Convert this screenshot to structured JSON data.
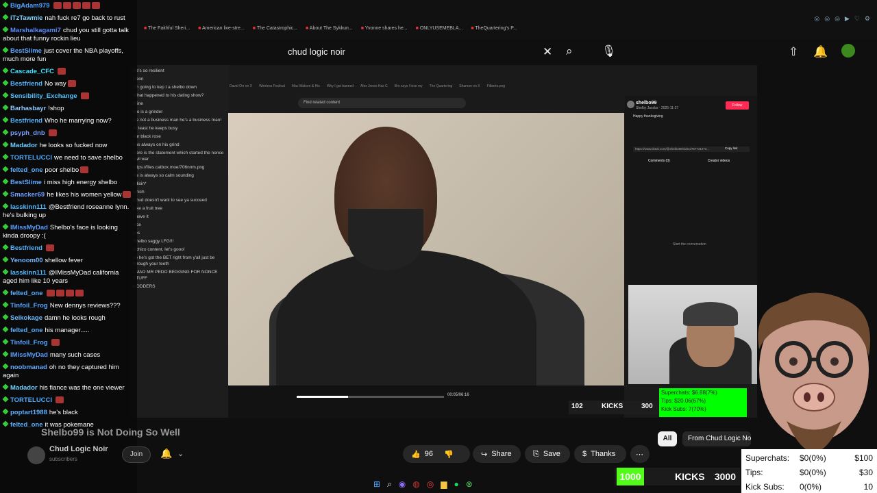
{
  "search": {
    "query": "chud logic noir"
  },
  "bookmarks": [
    "The Faithful Sheri...",
    "American live-stre...",
    "The Catastrophic...",
    "About The Sykkun...",
    "Yvonne shares he...",
    "ONLYUSEMEBLA...",
    "TheQuartering's P..."
  ],
  "chat": [
    {
      "user": "BigAdam979",
      "color": "#4ea1ff",
      "msg": "",
      "emotes": 5
    },
    {
      "user": "iTzTawmie",
      "color": "#7fd3ff",
      "msg": "nah fuck re7 go back to rust",
      "emotes": 0
    },
    {
      "user": "Marshalkagami7",
      "color": "#5b8cff",
      "msg": "chud you still gotta talk about that funny rockin lieu",
      "emotes": 0
    },
    {
      "user": "BestSlime",
      "color": "#5fa8ff",
      "msg": "just cover the NBA playoffs, much more fun",
      "emotes": 0
    },
    {
      "user": "Cascade_CFC",
      "color": "#3ce0ff",
      "msg": "",
      "emotes": 1
    },
    {
      "user": "Bestfriend",
      "color": "#4fb4ff",
      "msg": "No way",
      "emotes": 1
    },
    {
      "user": "Sensibility_Exchange",
      "color": "#4fc4ff",
      "msg": "",
      "emotes": 1
    },
    {
      "user": "Barhasbayr",
      "color": "#8ec8ff",
      "msg": "!shop",
      "emotes": 0
    },
    {
      "user": "Bestfriend",
      "color": "#4fb4ff",
      "msg": "Who he marrying now?",
      "emotes": 0
    },
    {
      "user": "psyph_dnb",
      "color": "#7a9dff",
      "msg": "",
      "emotes": 1
    },
    {
      "user": "Madador",
      "color": "#6fd0ff",
      "msg": "he looks so fucked now",
      "emotes": 0
    },
    {
      "user": "TORTELUCCI",
      "color": "#4aa8ff",
      "msg": "we need to save shelbo",
      "emotes": 0
    },
    {
      "user": "felted_one",
      "color": "#5ab2ff",
      "msg": "poor shelbo",
      "emotes": 1
    },
    {
      "user": "BestSlime",
      "color": "#5fa8ff",
      "msg": "i miss high energy shelbo",
      "emotes": 0
    },
    {
      "user": "Smacker69",
      "color": "#6ea0ff",
      "msg": "he likes his women yellow",
      "emotes": 1
    },
    {
      "user": "lasskinn111",
      "color": "#4fb8ff",
      "msg": "@Bestfriend roseanne lynn. he's bulking up",
      "emotes": 0
    },
    {
      "user": "IMissMyDad",
      "color": "#5a9cff",
      "msg": "Shelbo's face is looking kinda droopy :(",
      "emotes": 0
    },
    {
      "user": "Bestfriend",
      "color": "#4fb4ff",
      "msg": "",
      "emotes": 1
    },
    {
      "user": "Yenoom00",
      "color": "#73b8ff",
      "msg": "shellow fever",
      "emotes": 0
    },
    {
      "user": "lasskinn111",
      "color": "#4fb8ff",
      "msg": "@IMissMyDad california aged him like 10 years",
      "emotes": 0
    },
    {
      "user": "felted_one",
      "color": "#5ab2ff",
      "msg": "",
      "emotes": 4
    },
    {
      "user": "Tinfoil_Frog",
      "color": "#53a6ff",
      "msg": "New dennys reviews???",
      "emotes": 0
    },
    {
      "user": "Seikokage",
      "color": "#6bbcff",
      "msg": "damn he looks rough",
      "emotes": 0
    },
    {
      "user": "felted_one",
      "color": "#5ab2ff",
      "msg": "his manager.....",
      "emotes": 0
    },
    {
      "user": "Tinfoil_Frog",
      "color": "#53a6ff",
      "msg": "",
      "emotes": 1
    },
    {
      "user": "IMissMyDad",
      "color": "#5a9cff",
      "msg": "many such cases",
      "emotes": 0
    },
    {
      "user": "noobmanad",
      "color": "#66aaff",
      "msg": "oh no they captured him again",
      "emotes": 0
    },
    {
      "user": "Madador",
      "color": "#6fd0ff",
      "msg": "his fiance was the one viewer",
      "emotes": 0
    },
    {
      "user": "TORTELUCCI",
      "color": "#4aa8ff",
      "msg": "",
      "emotes": 1
    },
    {
      "user": "poptart1988",
      "color": "#5ab0ff",
      "msg": "he's black",
      "emotes": 0
    },
    {
      "user": "felted_one",
      "color": "#5ab2ff",
      "msg": "it was pokemane",
      "emotes": 0
    }
  ],
  "inner_chat": [
    "He's so resilient",
    "jifeon",
    "I'm going to kep t a shelbo down",
    "What happened to his dating show?",
    "Wine",
    "bro is a grinder",
    "He not a business man he's a business man!",
    "At least he keeps busy",
    "our black rose",
    "hes always on his grind",
    "Here is the statement which started the nonce civil war",
    "https://files.catbox.moe/706nnm.png",
    "He is always so calm sounding",
    "pdisin*",
    "which",
    "Chud doesn't want to see ya succeed",
    "Like a fruit tree",
    "I have it",
    "nice",
    "yes",
    "Shelbo saggy LFG!!!",
    "Schizo content, let's gooo!",
    "yo he's got the BET right from y'all just be through your teeth",
    "LMAO MR PEDO BEGGING FOR NONCE STUFF",
    "NODDERS"
  ],
  "inner_search_placeholder": "Find related content",
  "video_time": "00:05/06:16",
  "tiktok": {
    "user": "shelbo99",
    "sub": "Shelby Jacobs · 2025-11-27",
    "follow": "Follow",
    "caption": "Happy thanksgiving",
    "link": "https://www.tiktok.com/@shelbo99/video/757741273...",
    "copy": "Copy link",
    "tab1": "Comments (0)",
    "tab2": "Creator videos",
    "empty": "Start the conversation"
  },
  "inner_kicks": {
    "count": "102",
    "label": "KICKS",
    "goal": "300"
  },
  "inner_stats": {
    "superchats": "Superchats: $6.88(7%)",
    "tips": "Tips: $20.06(67%)",
    "kick_subs": "Kick Subs: 7(70%)"
  },
  "video": {
    "title": "Shelbo99 is Not Doing So Well",
    "channel": "Chud Logic Noir",
    "subscribers": "subscribers",
    "join": "Join",
    "likes": "96",
    "share": "Share",
    "save": "Save",
    "thanks": "Thanks"
  },
  "chips": {
    "all": "All",
    "from": "From Chud Logic Noir"
  },
  "kicks": {
    "count": "1000",
    "label": "KICKS",
    "goal": "3000"
  },
  "stats": [
    {
      "label": "Superchats:",
      "value": "$0(0%)",
      "goal": "$100"
    },
    {
      "label": "Tips:",
      "value": "$0(0%)",
      "goal": "$30"
    },
    {
      "label": "Kick Subs:",
      "value": "0(0%)",
      "goal": "10"
    }
  ],
  "progress": 0.35
}
